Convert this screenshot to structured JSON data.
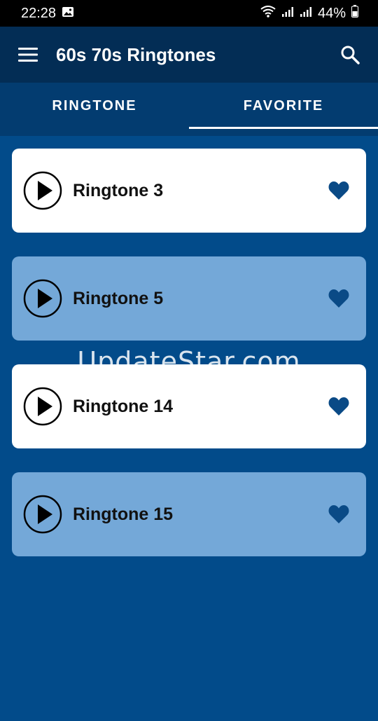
{
  "status": {
    "time": "22:28",
    "battery": "44%"
  },
  "appbar": {
    "title": "60s 70s Ringtones"
  },
  "tabs": [
    {
      "label": "RINGTONE",
      "active": false
    },
    {
      "label": "FAVORITE",
      "active": true
    }
  ],
  "ringtones": [
    {
      "title": "Ringtone 3"
    },
    {
      "title": "Ringtone 5"
    },
    {
      "title": "Ringtone 14"
    },
    {
      "title": "Ringtone 15"
    }
  ],
  "watermark": "UpdateStar.com",
  "colors": {
    "background": "#024b8a",
    "appbar": "#032d55",
    "tabbar": "#033c70",
    "card_light": "#ffffff",
    "card_blue": "#74a8d8",
    "heart": "#0a4a86"
  },
  "icons": [
    "menu-icon",
    "search-icon",
    "play-icon",
    "heart-icon",
    "wifi-icon",
    "signal-icon",
    "battery-icon",
    "image-icon"
  ]
}
